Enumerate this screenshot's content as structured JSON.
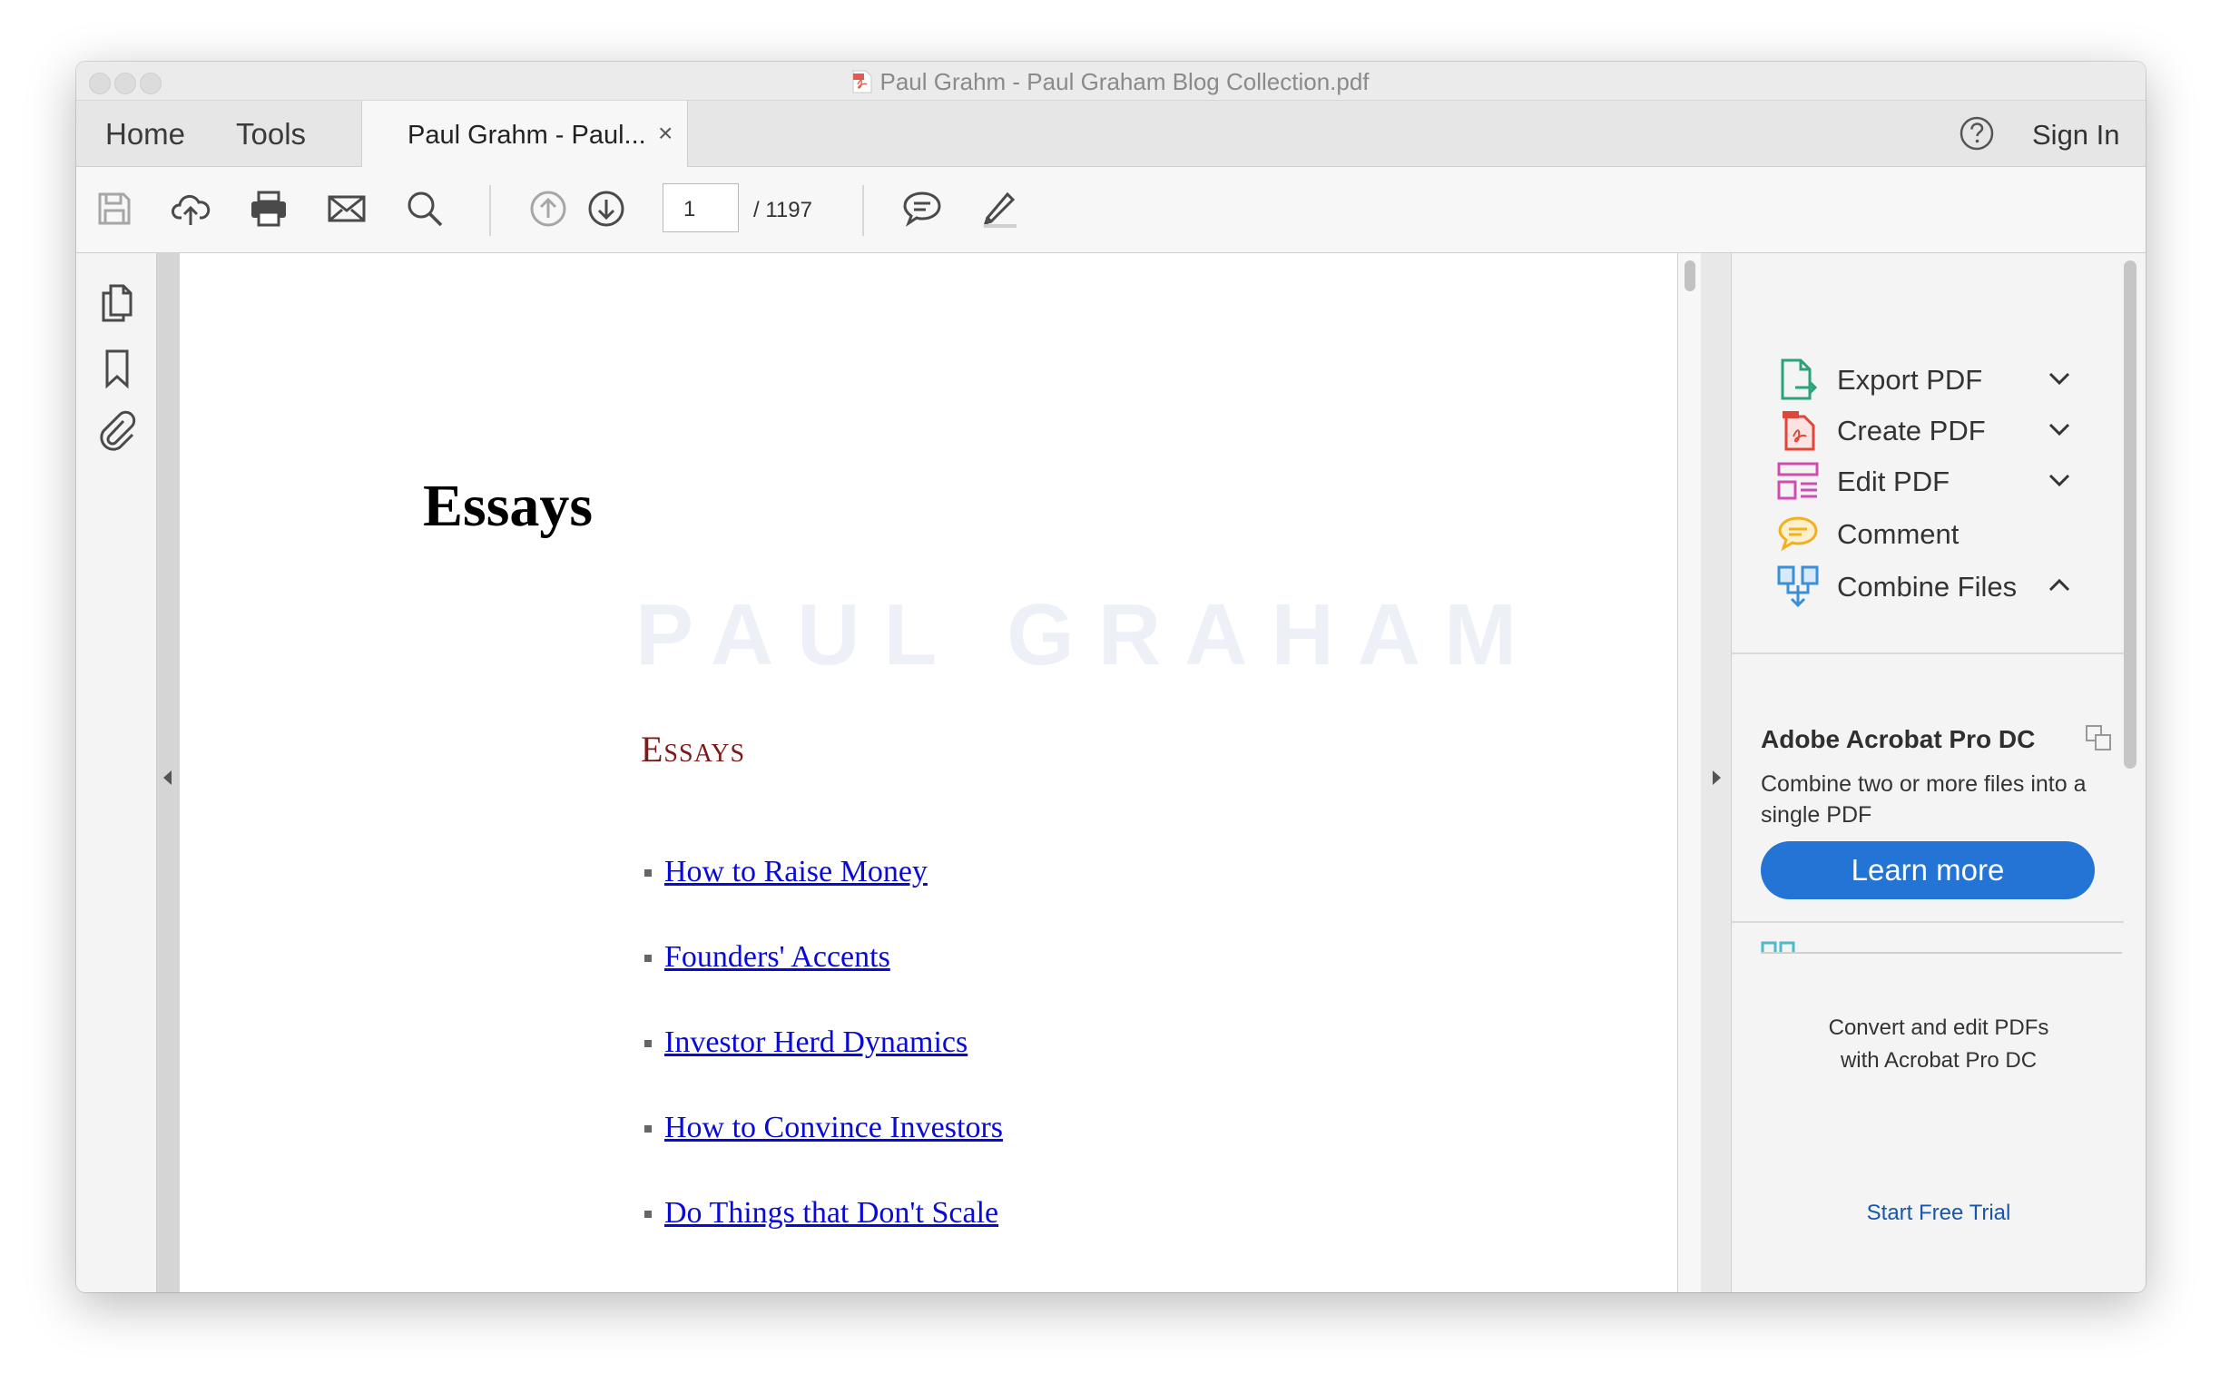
{
  "window": {
    "title": "Paul Grahm - Paul Graham Blog Collection.pdf"
  },
  "tabs": {
    "home": "Home",
    "tools": "Tools",
    "document_tab": "Paul Grahm - Paul...",
    "close_glyph": "×",
    "sign_in": "Sign In"
  },
  "toolbar": {
    "current_page": "1",
    "page_total": "/ 1197"
  },
  "right_panel": {
    "tools": [
      {
        "label": "Export PDF",
        "icon": "export-pdf-icon",
        "expanded": false
      },
      {
        "label": "Create PDF",
        "icon": "create-pdf-icon",
        "expanded": false
      },
      {
        "label": "Edit PDF",
        "icon": "edit-pdf-icon",
        "expanded": false
      },
      {
        "label": "Comment",
        "icon": "comment-icon"
      },
      {
        "label": "Combine Files",
        "icon": "combine-files-icon",
        "expanded": true
      }
    ],
    "promo_title": "Adobe Acrobat Pro DC",
    "promo_desc": "Combine two or more files into a single PDF",
    "learn_more": "Learn more",
    "cta_line1": "Convert and edit PDFs",
    "cta_line2": "with Acrobat Pro DC",
    "trial": "Start Free Trial"
  },
  "document": {
    "heading": "Essays",
    "watermark": "PAUL GRAHAM",
    "subheading": "Essays",
    "essays": [
      "How to Raise Money",
      "Founders' Accents",
      "Investor Herd Dynamics",
      "How to Convince Investors",
      "Do Things that Don't Scale"
    ]
  },
  "colors": {
    "accent_button": "#2374d4",
    "link": "#0a0ad6",
    "subheading": "#7b1a1a",
    "export_icon": "#2aa37a",
    "create_icon": "#e0463a",
    "edit_icon": "#d24bb0",
    "comment_icon": "#f2b01e",
    "combine_icon": "#3a8fd6"
  }
}
